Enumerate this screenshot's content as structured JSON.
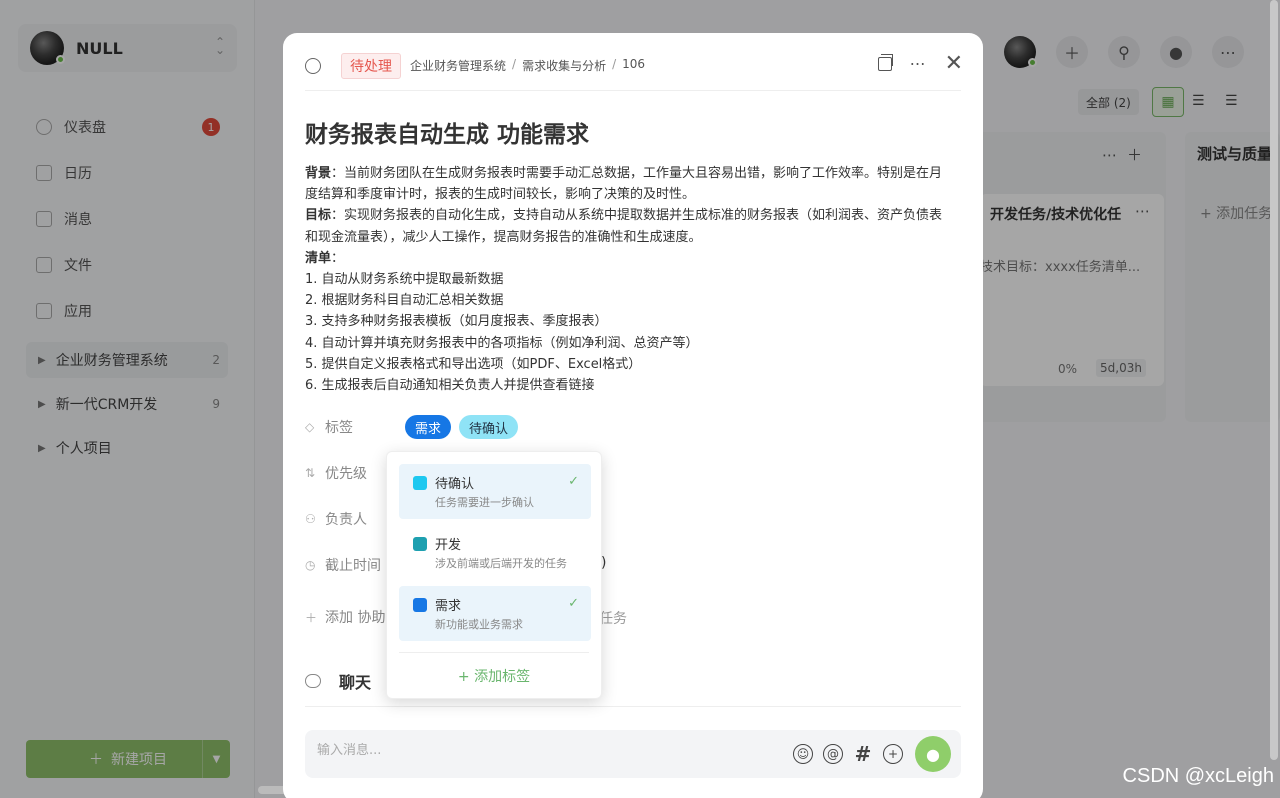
{
  "user": {
    "name": "NULL"
  },
  "sidebar": {
    "nav": [
      {
        "label": "仪表盘",
        "badge": "1"
      },
      {
        "label": "日历"
      },
      {
        "label": "消息"
      },
      {
        "label": "文件"
      },
      {
        "label": "应用"
      }
    ],
    "projects": [
      {
        "name": "企业财务管理系统",
        "count": "2"
      },
      {
        "name": "新一代CRM开发",
        "count": "9"
      },
      {
        "name": "个人项目",
        "count": ""
      }
    ],
    "new_project": "新建项目"
  },
  "board": {
    "filter_all": "全部 (2)",
    "column2_title": "测试与质量",
    "card": {
      "title": "开发任务/技术优化任",
      "desc": "技术目标：xxxx任务清单...",
      "progress": "0%",
      "time": "5d,03h"
    },
    "add_task": "+ 添加任务"
  },
  "modal": {
    "status_tag": "待处理",
    "breadcrumb": [
      "企业财务管理系统",
      "需求收集与分析",
      "106"
    ],
    "title": "财务报表自动生成 功能需求",
    "body": {
      "background_label": "背景",
      "background_text": "：当前财务团队在生成财务报表时需要手动汇总数据，工作量大且容易出错，影响了工作效率。特别是在月度结算和季度审计时，报表的生成时间较长，影响了决策的及时性。",
      "goal_label": "目标",
      "goal_text": "：实现财务报表的自动化生成，支持自动从系统中提取数据并生成标准的财务报表（如利润表、资产负债表和现金流量表），减少人工操作，提高财务报告的准确性和生成速度。",
      "list_label": "清单",
      "list_suffix": "：",
      "items": [
        "1. 自动从财务系统中提取最新数据",
        "2. 根据财务科目自动汇总相关数据",
        "3. 支持多种财务报表模板（如月度报表、季度报表）",
        "4. 自动计算并填充财务报表中的各项指标（例如净利润、总资产等）",
        "5. 提供自定义报表格式和导出选项（如PDF、Excel格式）",
        "6. 生成报表后自动通知相关负责人并提供查看链接"
      ]
    },
    "fields": {
      "tags_label": "标签",
      "priority_label": "优先级",
      "assignee_label": "负责人",
      "deadline_label": "截止时间",
      "add_label": "添加 协助",
      "deadline_tail": ")",
      "subtask_tail": "任务"
    },
    "tags": [
      "需求",
      "待确认"
    ],
    "chat_label": "聊天",
    "input_placeholder": "输入消息..."
  },
  "tag_dropdown": {
    "options": [
      {
        "name": "待确认",
        "desc": "任务需要进一步确认",
        "color": "#1ec8f0",
        "selected": true
      },
      {
        "name": "开发",
        "desc": "涉及前端或后端开发的任务",
        "color": "#1ea0b0",
        "selected": false
      },
      {
        "name": "需求",
        "desc": "新功能或业务需求",
        "color": "#1677e5",
        "selected": true
      }
    ],
    "add_label": "+ 添加标签",
    "check": "✓"
  },
  "watermark": "CSDN @xcLeigh"
}
